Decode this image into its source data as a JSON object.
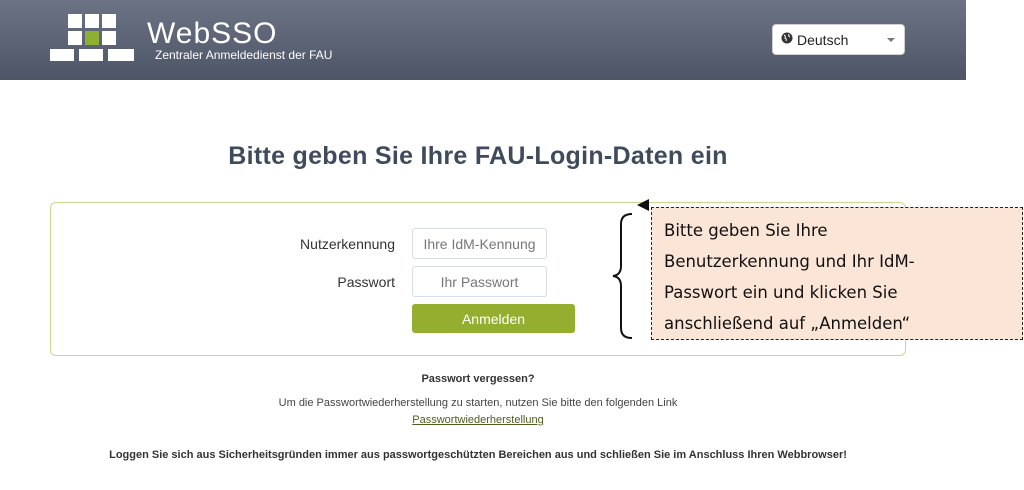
{
  "header": {
    "brand_name": "WebSSO",
    "brand_tagline": "Zentraler Anmeldedienst der FAU",
    "language": {
      "selected": "Deutsch",
      "icon": "globe-icon"
    }
  },
  "main": {
    "title": "Bitte geben Sie Ihre FAU-Login-Daten ein",
    "form": {
      "username_label": "Nutzerkennung",
      "username_placeholder": "Ihre IdM-Kennung",
      "password_label": "Passwort",
      "password_placeholder": "Ihr Passwort",
      "submit_label": "Anmelden"
    },
    "forgot": {
      "title": "Passwort vergessen?",
      "text": "Um die Passwortwiederherstellung zu starten, nutzen Sie bitte den folgenden Link",
      "link": "Passwortwiederherstellung"
    },
    "warning": "Loggen Sie sich aus Sicherheitsgründen immer aus passwortgeschützten Bereichen aus und schließen Sie im Anschluss Ihren Webbrowser!"
  },
  "annotation": {
    "lines": [
      "Bitte geben Sie Ihre",
      "Benutzerkennung und Ihr IdM-",
      "Passwort ein und klicken Sie",
      "anschließend auf „Anmelden“"
    ]
  },
  "colors": {
    "header": "#5d6577",
    "accent_green": "#94ae2f",
    "callout_fill": "#fbe5d6"
  }
}
